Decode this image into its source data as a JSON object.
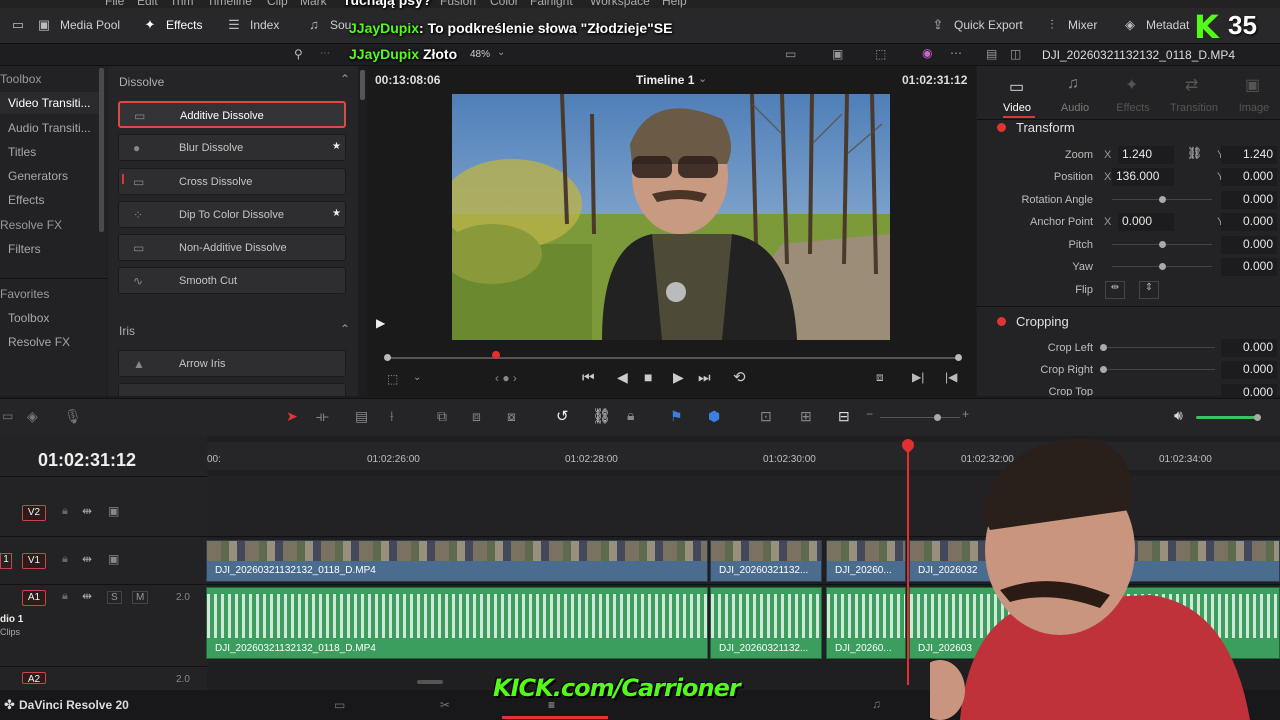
{
  "menubar": [
    "File",
    "Edit",
    "Trim",
    "Timeline",
    "Clip",
    "Mark",
    "Fusion",
    "Color",
    "Fairlight",
    "Workspace",
    "Help"
  ],
  "toolbar": {
    "media_pool": "Media Pool",
    "effects": "Effects",
    "index": "Index",
    "sound": "Sou",
    "quick_export": "Quick Export",
    "mixer": "Mixer",
    "metadata": "Metadat"
  },
  "subbar": {
    "zoom": "48%",
    "clip_name": "DJI_20260321132132_0118_D.MP4"
  },
  "leftnav": {
    "toolbox": "Toolbox",
    "items": [
      "Video Transiti...",
      "Audio Transiti...",
      "Titles",
      "Generators",
      "Effects"
    ],
    "resolve_fx": "Resolve FX",
    "filters": "Filters",
    "favorites": "Favorites",
    "fav_items": [
      "Toolbox",
      "Resolve FX"
    ]
  },
  "effects": {
    "dissolve_head": "Dissolve",
    "dissolve": [
      "Additive Dissolve",
      "Blur Dissolve",
      "Cross Dissolve",
      "Dip To Color Dissolve",
      "Non-Additive Dissolve",
      "Smooth Cut"
    ],
    "iris_head": "Iris",
    "iris": [
      "Arrow Iris"
    ]
  },
  "viewer": {
    "timecode_left": "00:13:08:06",
    "timeline_name": "Timeline 1",
    "timecode_right": "01:02:31:12"
  },
  "inspector": {
    "tabs": [
      "Video",
      "Audio",
      "Effects",
      "Transition",
      "Image"
    ],
    "transform": "Transform",
    "zoom_label": "Zoom",
    "zoom_x": "1.240",
    "zoom_y": "1.240",
    "position_label": "Position",
    "pos_x": "136.000",
    "pos_y": "0.000",
    "rotation_label": "Rotation Angle",
    "rotation": "0.000",
    "anchor_label": "Anchor Point",
    "anchor_x": "0.000",
    "anchor_y": "0.000",
    "pitch_label": "Pitch",
    "pitch": "0.000",
    "yaw_label": "Yaw",
    "yaw": "0.000",
    "flip_label": "Flip",
    "cropping": "Cropping",
    "crop_left_label": "Crop Left",
    "crop_left": "0.000",
    "crop_right_label": "Crop Right",
    "crop_right": "0.000",
    "crop_top_label": "Crop Top",
    "crop_top": "0.000",
    "x_axis": "X",
    "y_axis": "Y"
  },
  "timeline": {
    "timecode": "01:02:31:12",
    "ruler": [
      "00:",
      "01:02:26:00",
      "01:02:28:00",
      "01:02:30:00",
      "01:02:32:00",
      "01:02:34:00"
    ],
    "tracks": {
      "v2": "V2",
      "v1": "V1",
      "a1": "A1",
      "a2": "A2",
      "a1_level": "2.0",
      "a2_level": "2.0",
      "audio_name": "dio 1",
      "clips": "Clips",
      "v1_num": "1",
      "solo": "S",
      "mute": "M"
    },
    "video_clips": [
      "DJI_20260321132132_0118_D.MP4",
      "DJI_20260321132...",
      "DJI_20260...",
      "DJI_2026032"
    ],
    "audio_clips": [
      "DJI_20260321132132_0118_D.MP4",
      "DJI_20260321132...",
      "DJI_20260...",
      "DJI_202603"
    ]
  },
  "bottombar": {
    "app_name": "DaVinci Resolve 20"
  },
  "overlay": {
    "chat_top": "ruchają psy?",
    "chat1_user": "JJayDupix",
    "chat1_text": ": To podkreślenie słowa \"Złodzieje\"",
    "chat1_suffix": "SE",
    "chat2_user": "JJayDupix",
    "chat2_text": "Złoto",
    "kick_count": "35",
    "kick_letter": "K",
    "kick_url": "KICK.com/Carrioner"
  },
  "colors": {
    "kick_green": "#53fc18",
    "accent_red": "#e03535",
    "audio_green": "#3c9e5e",
    "video_blue": "#4a6c8e"
  }
}
